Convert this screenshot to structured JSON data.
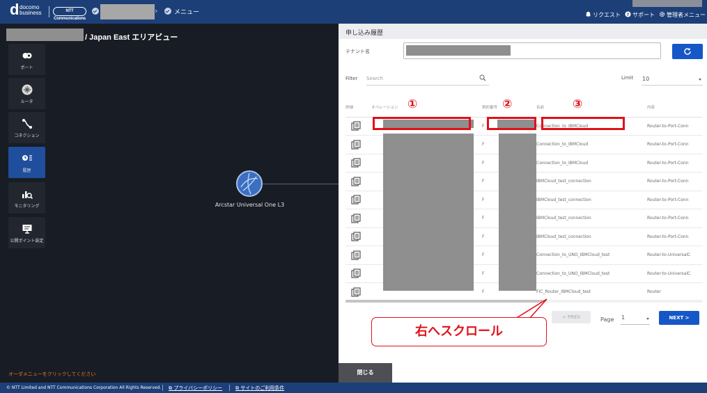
{
  "header": {
    "logo_letter": "d",
    "logo_text": "docomo\nbusiness",
    "ntt_logo": "NTT Communications",
    "breadcrumb_menu": "メニュー",
    "links": [
      {
        "label": "リクエスト",
        "icon": "bell-icon"
      },
      {
        "label": "サポート",
        "icon": "help-icon"
      },
      {
        "label": "管理者メニュー",
        "icon": "gear-icon"
      }
    ]
  },
  "area": {
    "title": "/ Japan East エリアビュー",
    "order_hint": "オーダメニューをクリックしてください"
  },
  "sidebar": {
    "items": [
      {
        "label": "ポート",
        "icon": "port-icon",
        "active": false
      },
      {
        "label": "ルータ",
        "icon": "router-icon",
        "active": false
      },
      {
        "label": "コネクション",
        "icon": "connection-icon",
        "active": false
      },
      {
        "label": "履歴",
        "icon": "history-icon",
        "active": true
      },
      {
        "label": "モニタリング",
        "icon": "monitoring-icon",
        "active": false
      },
      {
        "label": "公開ポイント設定",
        "icon": "monitor-icon",
        "active": false
      }
    ]
  },
  "canvas": {
    "node_label": "Arcstar Universal One L3"
  },
  "panel": {
    "title": "申し込み履歴",
    "tenant_label": "テナント名",
    "filter_label": "Filter",
    "search_placeholder": "Search",
    "limit_label": "Limit",
    "limit_value": "10",
    "columns": [
      "詳細",
      "オペレーション",
      "契約番号",
      "名前",
      "内容"
    ],
    "rows": [
      {
        "contract": "F",
        "name": "Connection_to_IBMCloud",
        "content": "Router-to-Port-Conn"
      },
      {
        "contract": "F",
        "name": "Connection_to_IBMCloud",
        "content": "Router-to-Port-Conn"
      },
      {
        "contract": "F",
        "name": "Connection_to_IBMCloud",
        "content": "Router-to-Port-Conn"
      },
      {
        "contract": "F",
        "name": "IBMCloud_test_connection",
        "content": "Router-to-Port-Conn"
      },
      {
        "contract": "F",
        "name": "IBMCloud_test_connection",
        "content": "Router-to-Port-Conn"
      },
      {
        "contract": "F",
        "name": "IBMCloud_test_connection",
        "content": "Router-to-Port-Conn"
      },
      {
        "contract": "F",
        "name": "IBMCloud_test_connection",
        "content": "Router-to-Port-Conn"
      },
      {
        "contract": "F",
        "name": "Connection_to_UNO_IBMCloud_test",
        "content": "Router-to-UniversalC"
      },
      {
        "contract": "F",
        "name": "Connection_to_UNO_IBMCloud_test",
        "content": "Router-to-UniversalC"
      },
      {
        "contract": "F",
        "name": "FIC_Router_IBMCloud_test",
        "content": "Router"
      }
    ],
    "prev_label": "< PREV",
    "page_label": "Page",
    "page_value": "1",
    "next_label": "NEXT >",
    "close_label": "閉じる"
  },
  "annotations": {
    "markers": [
      "①",
      "②",
      "③"
    ],
    "scroll_callout": "右へスクロール",
    "color": "#e0101a"
  },
  "footer": {
    "copyright": "© NTT Limited and NTT Communications Corporation All Rights Reserved.",
    "privacy": "プライバシーポリシー",
    "terms": "サイトのご利用条件"
  },
  "colors": {
    "brand_blue": "#1c3f78",
    "button_blue": "#1557c7",
    "active_sidebar": "#1f4e9c",
    "accent_orange": "#e77a27"
  }
}
